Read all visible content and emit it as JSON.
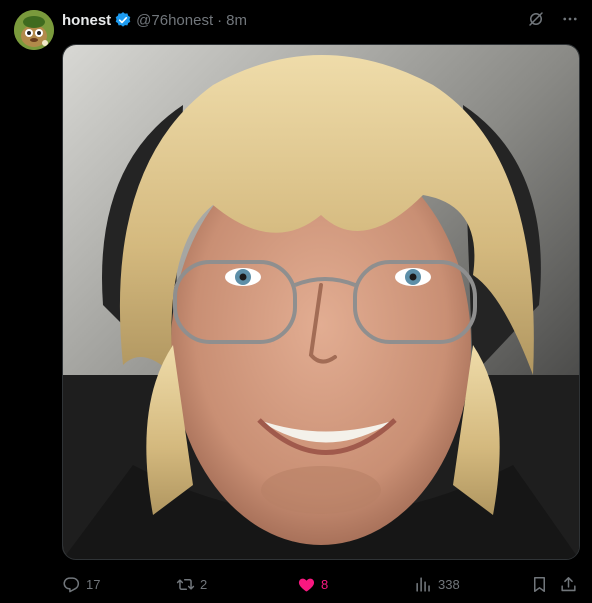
{
  "post": {
    "author": {
      "display_name": "honest",
      "handle": "@76honest",
      "verified": true,
      "avatar_icon": "cartoon-creature-avatar"
    },
    "separator": "·",
    "time_ago": "8m",
    "top_icons": [
      "grok-icon",
      "more-icon"
    ],
    "media": {
      "description_icon": "photo",
      "aspect": "square"
    },
    "actions": {
      "reply_count": "17",
      "repost_count": "2",
      "like_count": "8",
      "view_count": "338",
      "liked": true
    }
  },
  "colors": {
    "background": "#000000",
    "text_primary": "#e7e9ea",
    "text_secondary": "#71767b",
    "verified": "#1d9bf0",
    "like_active": "#f91880",
    "border": "#2f3336"
  }
}
